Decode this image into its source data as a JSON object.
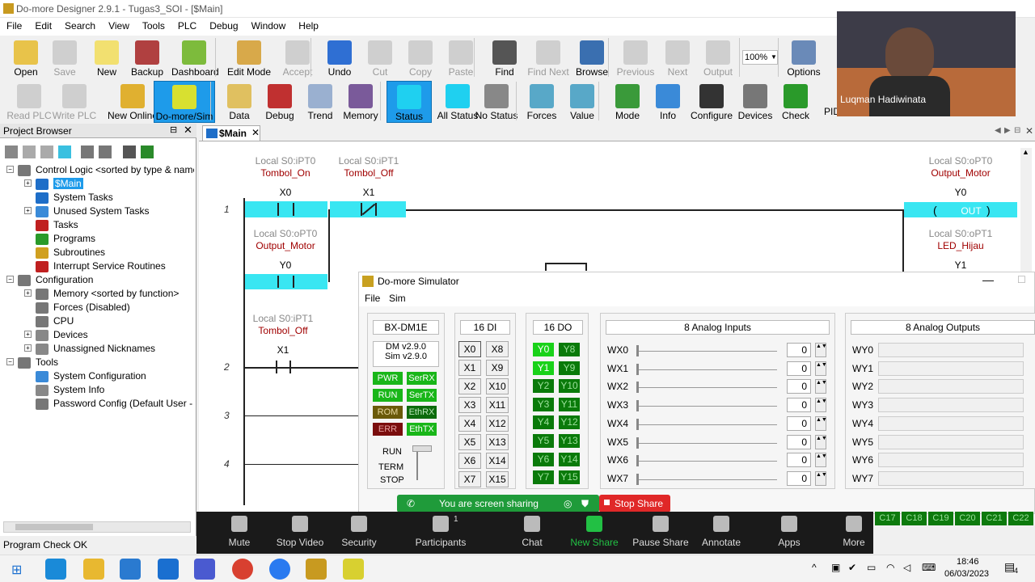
{
  "window": {
    "title": "Do-more Designer 2.9.1 - Tugas3_SOI - [$Main]"
  },
  "menu": [
    "File",
    "Edit",
    "Search",
    "View",
    "Tools",
    "PLC",
    "Debug",
    "Window",
    "Help"
  ],
  "toolbar1": [
    {
      "label": "Open",
      "icon": "open-folder-icon",
      "enabled": true,
      "color": "#e8c34a"
    },
    {
      "label": "Save",
      "icon": "save-icon",
      "enabled": false
    },
    {
      "label": "New",
      "icon": "new-file-icon",
      "enabled": true,
      "color": "#f2e070"
    },
    {
      "label": "Backup",
      "icon": "backup-icon",
      "enabled": true,
      "color": "#b04040"
    },
    {
      "label": "Dashboard",
      "icon": "dashboard-icon",
      "enabled": true,
      "color": "#7dbb3c"
    },
    {
      "label": "Edit Mode",
      "icon": "edit-mode-icon",
      "enabled": true,
      "color": "#d8a94a"
    },
    {
      "label": "Accept",
      "icon": "accept-icon",
      "enabled": false
    },
    {
      "label": "Undo",
      "icon": "undo-icon",
      "enabled": true,
      "color": "#2f6fd3"
    },
    {
      "label": "Cut",
      "icon": "cut-icon",
      "enabled": false
    },
    {
      "label": "Copy",
      "icon": "copy-icon",
      "enabled": false
    },
    {
      "label": "Paste",
      "icon": "paste-icon",
      "enabled": false
    },
    {
      "label": "Find",
      "icon": "binoculars-icon",
      "enabled": true,
      "color": "#555555"
    },
    {
      "label": "Find Next",
      "icon": "find-next-icon",
      "enabled": false
    },
    {
      "label": "Browse",
      "icon": "browse-icon",
      "enabled": true,
      "color": "#3a6fb0"
    },
    {
      "label": "Previous",
      "icon": "previous-icon",
      "enabled": false
    },
    {
      "label": "Next",
      "icon": "next-icon",
      "enabled": false
    },
    {
      "label": "Output",
      "icon": "output-icon",
      "enabled": false
    },
    {
      "label": "Options",
      "icon": "options-icon",
      "enabled": true,
      "color": "#6a8ab8"
    }
  ],
  "zoom_level": "100%",
  "toolbar2": [
    {
      "label": "Read PLC",
      "icon": "read-plc-icon",
      "enabled": false
    },
    {
      "label": "Write PLC",
      "icon": "write-plc-icon",
      "enabled": false
    },
    {
      "label": "New Online",
      "icon": "new-online-icon",
      "enabled": true,
      "color": "#e0b030"
    },
    {
      "label": "Do-more/Sim",
      "icon": "simulator-icon",
      "enabled": true,
      "selected": true,
      "color": "#d8e030"
    },
    {
      "label": "Data",
      "icon": "data-icon",
      "enabled": true,
      "color": "#e0c060"
    },
    {
      "label": "Debug",
      "icon": "debug-icon",
      "enabled": true,
      "color": "#c03030"
    },
    {
      "label": "Trend",
      "icon": "trend-icon",
      "enabled": true,
      "color": "#9ab0d0"
    },
    {
      "label": "Memory",
      "icon": "memory-icon",
      "enabled": true,
      "color": "#7a5a9a"
    },
    {
      "label": "Status",
      "icon": "status-icon",
      "enabled": true,
      "selected": true,
      "color": "#1fd0f0"
    },
    {
      "label": "All Status",
      "icon": "all-status-icon",
      "enabled": true,
      "color": "#1fd0f0"
    },
    {
      "label": "No Status",
      "icon": "no-status-icon",
      "enabled": true,
      "color": "#888888"
    },
    {
      "label": "Forces",
      "icon": "forces-icon",
      "enabled": true,
      "color": "#58a8c8"
    },
    {
      "label": "Value",
      "icon": "value-icon",
      "enabled": true,
      "color": "#58a8c8"
    },
    {
      "label": "Mode",
      "icon": "traffic-light-icon",
      "enabled": true,
      "color": "#3a9a3a"
    },
    {
      "label": "Info",
      "icon": "info-icon",
      "enabled": true,
      "color": "#3a8ad8"
    },
    {
      "label": "Configure",
      "icon": "configure-xy-icon",
      "enabled": true,
      "color": "#333333"
    },
    {
      "label": "Devices",
      "icon": "devices-icon",
      "enabled": true,
      "color": "#777777"
    },
    {
      "label": "Check",
      "icon": "check-icon",
      "enabled": true,
      "color": "#2a9a2a"
    }
  ],
  "toolbar2_extra": "PID Overview   Mb View",
  "project_browser": {
    "title": "Project Browser",
    "items": [
      {
        "label": "Control Logic <sorted by type & name>",
        "icon": "control-logic-icon",
        "level": 0
      },
      {
        "label": "$Main",
        "icon": "main-program-icon",
        "level": 1,
        "selected": true
      },
      {
        "label": "System Tasks",
        "icon": "system-tasks-icon",
        "level": 1
      },
      {
        "label": "Unused System Tasks",
        "icon": "unused-tasks-icon",
        "level": 1
      },
      {
        "label": "Tasks",
        "icon": "tasks-icon",
        "level": 1
      },
      {
        "label": "Programs",
        "icon": "programs-icon",
        "level": 1
      },
      {
        "label": "Subroutines",
        "icon": "subroutines-icon",
        "level": 1
      },
      {
        "label": "Interrupt Service Routines",
        "icon": "isr-icon",
        "level": 1
      },
      {
        "label": "Configuration",
        "icon": "configuration-icon",
        "level": 0
      },
      {
        "label": "Memory <sorted by function>",
        "icon": "memory-icon",
        "level": 1
      },
      {
        "label": "Forces (Disabled)",
        "icon": "forces-icon",
        "level": 1
      },
      {
        "label": "CPU",
        "icon": "cpu-icon",
        "level": 1
      },
      {
        "label": "Devices",
        "icon": "devices-icon",
        "level": 1
      },
      {
        "label": "Unassigned Nicknames",
        "icon": "nicknames-icon",
        "level": 1
      },
      {
        "label": "Tools",
        "icon": "tools-icon",
        "level": 0
      },
      {
        "label": "System Configuration",
        "icon": "system-config-icon",
        "level": 1
      },
      {
        "label": "System Info",
        "icon": "system-info-icon",
        "level": 1
      },
      {
        "label": "Password Config (Default User - R",
        "icon": "password-icon",
        "level": 1
      }
    ]
  },
  "status_text": "Program Check OK",
  "editor": {
    "tab": "$Main",
    "rung1": {
      "number": "1",
      "c1": {
        "addr": "Local S0:iPT0",
        "nick": "Tombol_On",
        "elem": "X0"
      },
      "c2": {
        "addr": "Local S0:iPT1",
        "nick": "Tombol_Off",
        "elem": "X1"
      },
      "c3": {
        "addr": "Local S0:oPT0",
        "nick": "Output_Motor",
        "elem": "Y0"
      },
      "coil": {
        "addr": "Local S0:oPT0",
        "nick": "Output_Motor",
        "elem": "Y0",
        "label": "OUT"
      },
      "coil2": {
        "addr": "Local S0:oPT1",
        "nick": "LED_Hijau",
        "elem": "Y1"
      }
    },
    "rung2": {
      "number": "2",
      "c1": {
        "addr": "Local S0:iPT1",
        "nick": "Tombol_Off",
        "elem": "X1"
      }
    },
    "rung3": "3",
    "rung4": "4"
  },
  "simulator": {
    "title": "Do-more Simulator",
    "menu": [
      "File",
      "Sim"
    ],
    "model": "BX-DM1E",
    "version1": "DM v2.9.0",
    "version2": "Sim v2.9.0",
    "leds": [
      [
        "PWR",
        "SerRX"
      ],
      [
        "RUN",
        "SerTX"
      ],
      [
        "ROM",
        "EthRX"
      ],
      [
        "ERR",
        "EthTX"
      ]
    ],
    "mode_labels": [
      "RUN",
      "TERM",
      "STOP"
    ],
    "di_title": "16 DI",
    "di": [
      [
        "X0",
        "X8"
      ],
      [
        "X1",
        "X9"
      ],
      [
        "X2",
        "X10"
      ],
      [
        "X3",
        "X11"
      ],
      [
        "X4",
        "X12"
      ],
      [
        "X5",
        "X13"
      ],
      [
        "X6",
        "X14"
      ],
      [
        "X7",
        "X15"
      ]
    ],
    "do_title": "16 DO",
    "do": [
      [
        "Y0",
        "Y8"
      ],
      [
        "Y1",
        "Y9"
      ],
      [
        "Y2",
        "Y10"
      ],
      [
        "Y3",
        "Y11"
      ],
      [
        "Y4",
        "Y12"
      ],
      [
        "Y5",
        "Y13"
      ],
      [
        "Y6",
        "Y14"
      ],
      [
        "Y7",
        "Y15"
      ]
    ],
    "ai_title": "8 Analog Inputs",
    "ai": [
      {
        "name": "WX0",
        "value": "0"
      },
      {
        "name": "WX1",
        "value": "0"
      },
      {
        "name": "WX2",
        "value": "0"
      },
      {
        "name": "WX3",
        "value": "0"
      },
      {
        "name": "WX4",
        "value": "0"
      },
      {
        "name": "WX5",
        "value": "0"
      },
      {
        "name": "WX6",
        "value": "0"
      },
      {
        "name": "WX7",
        "value": "0"
      }
    ],
    "ao_title": "8 Analog Outputs",
    "ao": [
      "WY0",
      "WY1",
      "WY2",
      "WY3",
      "WY4",
      "WY5",
      "WY6",
      "WY7"
    ],
    "counters": [
      "C17",
      "C18",
      "C19",
      "C20",
      "C21",
      "C22"
    ]
  },
  "zoom": {
    "sharing": "You are screen sharing",
    "stop": "Stop Share",
    "buttons": [
      "Mute",
      "Stop Video",
      "Security",
      "Participants",
      "Chat",
      "New Share",
      "Pause Share",
      "Annotate",
      "Apps",
      "More"
    ],
    "participants_count": "1"
  },
  "webcam": {
    "name": "Luqman Hadiwinata"
  },
  "taskbar": {
    "time": "18:46",
    "date": "06/03/2023",
    "notification_count": "4"
  }
}
